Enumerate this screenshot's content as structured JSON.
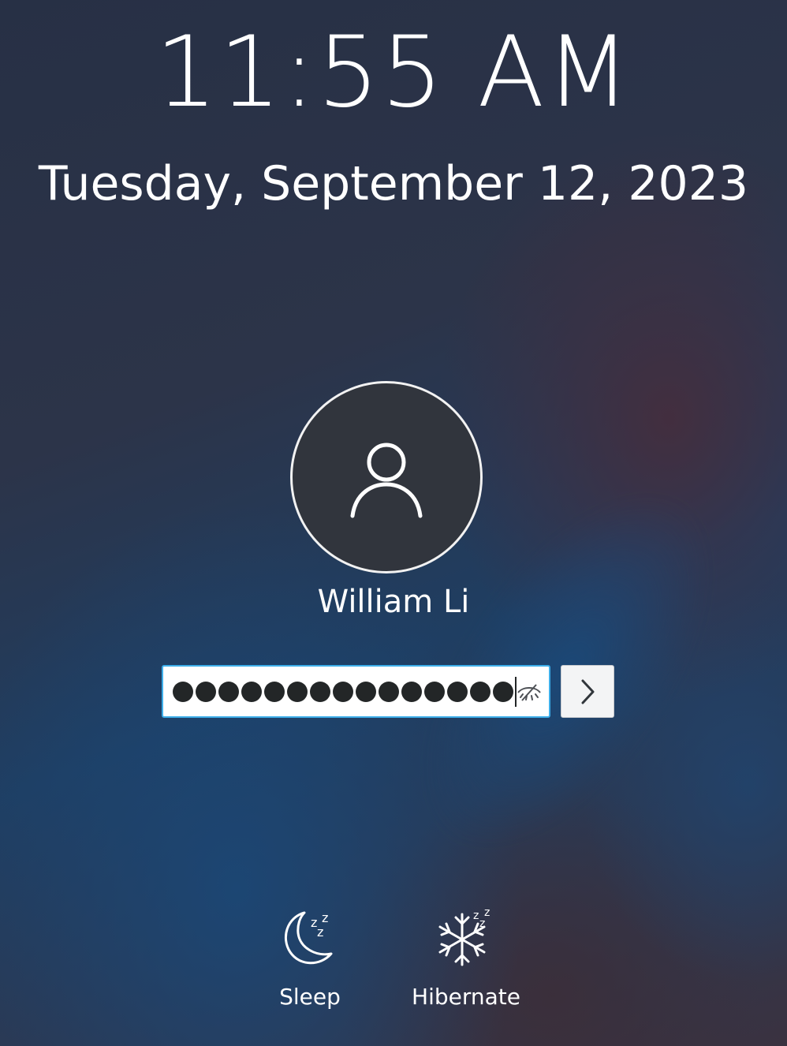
{
  "lock_screen": {
    "time": "11:55 AM",
    "date": "Tuesday, September 12, 2023"
  },
  "user": {
    "name": "William Li",
    "avatar_icon": "user-icon"
  },
  "password_field": {
    "masked_char_count": 15,
    "reveal_icon": "eye-hidden-icon"
  },
  "login_button": {
    "icon": "chevron-right-icon"
  },
  "actions": [
    {
      "label": "Sleep",
      "icon": "sleep-moon-icon"
    },
    {
      "label": "Hibernate",
      "icon": "hibernate-snowflake-icon"
    }
  ],
  "colors": {
    "accent": "#3daee9",
    "text": "#ffffff"
  }
}
